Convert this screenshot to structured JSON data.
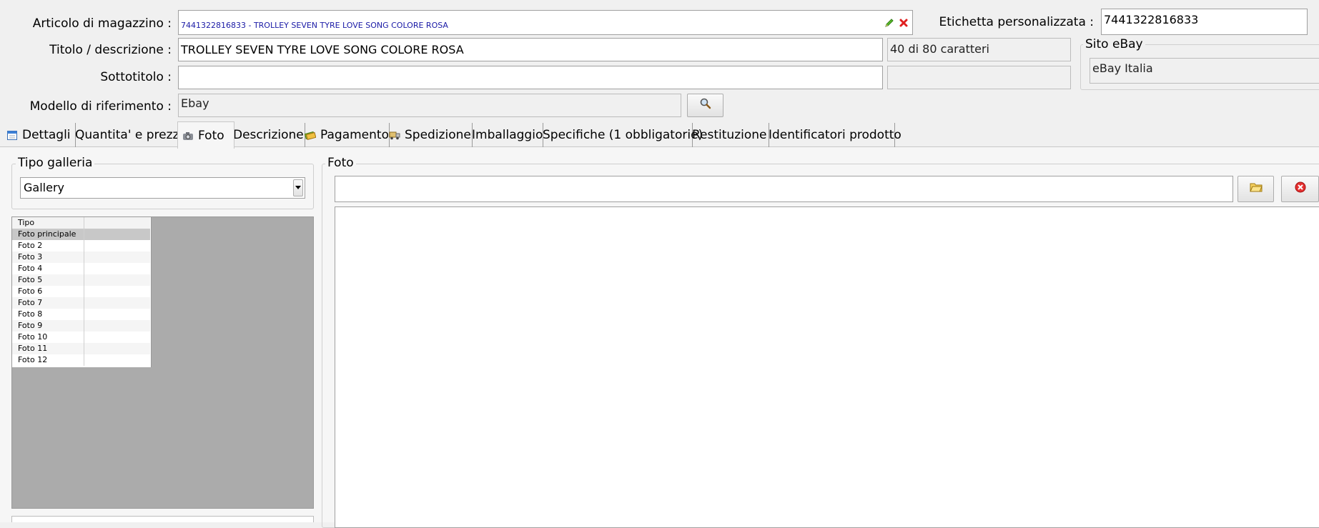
{
  "header": {
    "articolo_label": "Articolo di magazzino :",
    "articolo_value": "7441322816833 - TROLLEY SEVEN TYRE LOVE SONG COLORE ROSA",
    "etichetta_label": "Etichetta personalizzata :",
    "etichetta_value": "7441322816833",
    "titolo_label": "Titolo / descrizione :",
    "titolo_value": "TROLLEY SEVEN TYRE LOVE SONG COLORE ROSA",
    "char_count": "40 di 80 caratteri",
    "sottotitolo_label": "Sottotitolo :",
    "sottotitolo_value": "",
    "modello_label": "Modello di riferimento :",
    "modello_value": "Ebay",
    "sito_legend": "Sito eBay",
    "sito_value": "eBay Italia"
  },
  "tabs": [
    {
      "label": "Dettagli",
      "icon": "calendar-icon"
    },
    {
      "label": "Quantita' e prezzo",
      "icon": ""
    },
    {
      "label": "Foto",
      "icon": "camera-icon",
      "active": true
    },
    {
      "label": "Descrizione",
      "icon": ""
    },
    {
      "label": "Pagamento",
      "icon": "money-icon"
    },
    {
      "label": "Spedizione",
      "icon": "shipping-icon"
    },
    {
      "label": "Imballaggio",
      "icon": ""
    },
    {
      "label": "Specifiche (1 obbligatorie)",
      "icon": ""
    },
    {
      "label": "Restituzione",
      "icon": ""
    },
    {
      "label": "Identificatori prodotto",
      "icon": ""
    }
  ],
  "gallery": {
    "legend": "Tipo galleria",
    "selected": "Gallery",
    "grid_header": "Tipo",
    "rows": [
      "Foto principale",
      "Foto 2",
      "Foto 3",
      "Foto 4",
      "Foto 5",
      "Foto 6",
      "Foto 7",
      "Foto 8",
      "Foto 9",
      "Foto 10",
      "Foto 11",
      "Foto 12"
    ]
  },
  "foto": {
    "legend": "Foto",
    "path_value": ""
  },
  "colors": {
    "link_blue": "#1a1aa6",
    "delete_red": "#e02020",
    "pencil_green": "#3a9a20",
    "grid_bg": "#ababab"
  }
}
